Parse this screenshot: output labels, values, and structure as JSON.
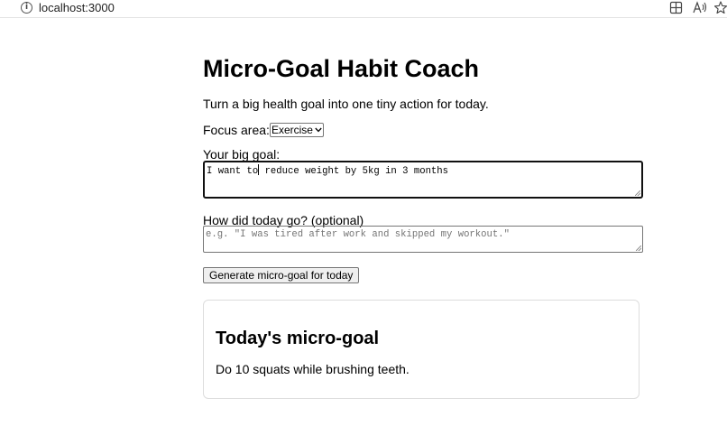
{
  "browser": {
    "url": "localhost:3000",
    "info_icon_glyph": "i",
    "icons": [
      "info-icon",
      "split-screen-icon",
      "read-aloud-icon",
      "favorite-star-icon"
    ]
  },
  "page": {
    "title": "Micro-Goal Habit Coach",
    "subtitle": "Turn a big health goal into one tiny action for today."
  },
  "focus": {
    "label": "Focus area:",
    "selected": "Exercise",
    "chevron": "⌄"
  },
  "big_goal": {
    "label": "Your big goal:",
    "value_before_caret": "I want to",
    "value_after_caret": " reduce weight by 5kg in 3 months"
  },
  "today": {
    "label": "How did today go? (optional)",
    "placeholder": "e.g. \"I was tired after work and skipped my workout.\""
  },
  "actions": {
    "generate_label": "Generate micro-goal for today"
  },
  "result": {
    "title": "Today's micro-goal",
    "text": "Do 10 squats while brushing teeth."
  },
  "colors": {
    "page_background": "#ffffff",
    "text": "#000000",
    "placeholder": "#757575",
    "button_background": "#efefef",
    "card_border": "#dddddd"
  }
}
